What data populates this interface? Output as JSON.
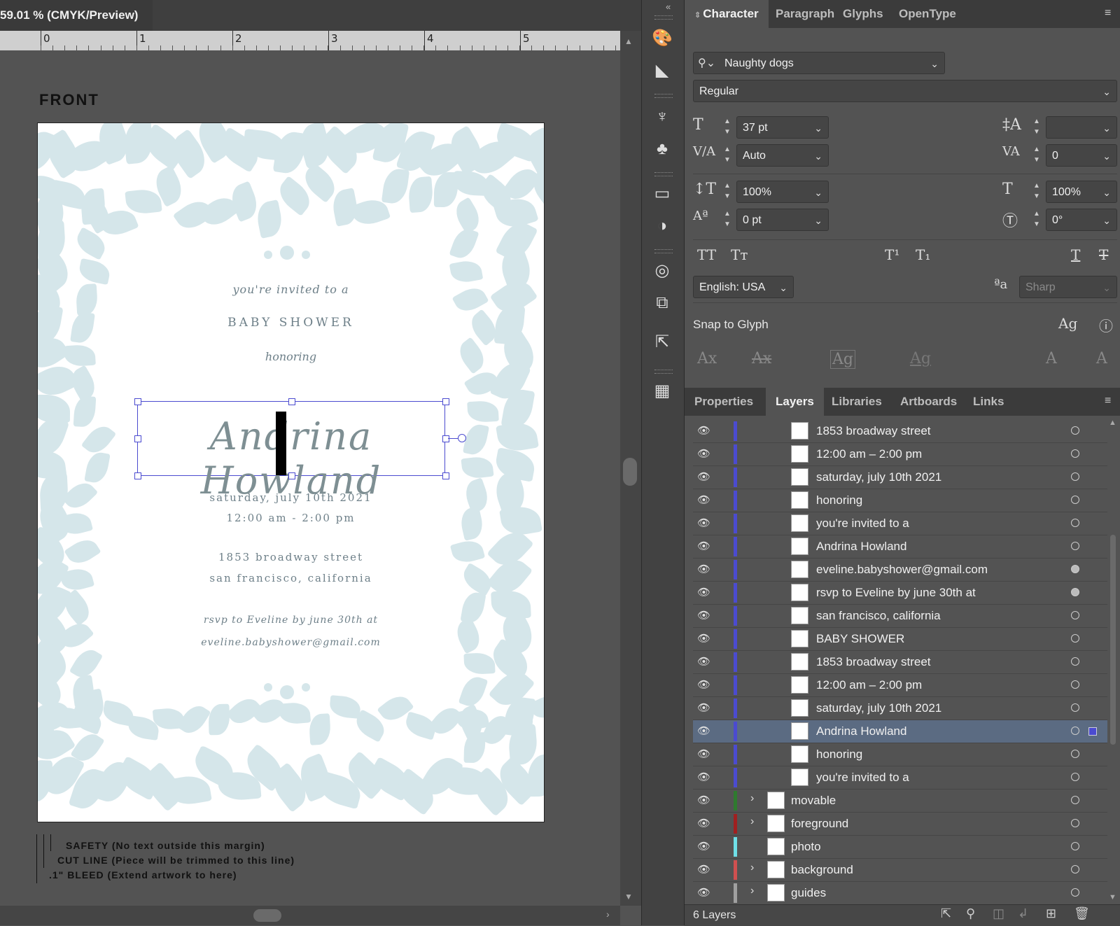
{
  "document": {
    "tab_title": "59.01 % (CMYK/Preview)",
    "ruler_labels": [
      "0",
      "1",
      "2",
      "3",
      "4",
      "5"
    ],
    "front_label": "FRONT",
    "invitation": {
      "line1": "you're invited to a",
      "line2": "BABY SHOWER",
      "line3": "honoring",
      "name": "Andrina Howland",
      "date": "saturday, july 10th 2021",
      "time": "12:00 am - 2:00 pm",
      "street": "1853 broadway street",
      "city": "san francisco, california",
      "rsvp": "rsvp to Eveline by june 30th at",
      "email": "eveline.babyshower@gmail.com"
    },
    "legend": [
      "SAFETY (No text outside this margin)",
      "CUT LINE (Piece will be trimmed to this line)",
      ".1\" BLEED (Extend artwork to here)"
    ]
  },
  "character_panel": {
    "tabs": [
      "Character",
      "Paragraph",
      "Glyphs",
      "OpenType"
    ],
    "font_family": "Naughty dogs",
    "font_style": "Regular",
    "font_size": "37 pt",
    "leading": "",
    "kerning": "Auto",
    "tracking": "0",
    "vertical_scale": "100%",
    "horizontal_scale": "100%",
    "baseline_shift": "0 pt",
    "rotation": "0°",
    "language": "English: USA",
    "antialias": "Sharp",
    "snap_to_glyph": "Snap to Glyph"
  },
  "layers_panel": {
    "tabs": [
      "Properties",
      "Layers",
      "Libraries",
      "Artboards",
      "Links"
    ],
    "rows": [
      {
        "name": "1853 broadway street",
        "selected": false,
        "filled": false
      },
      {
        "name": "12:00 am – 2:00 pm",
        "selected": false,
        "filled": false
      },
      {
        "name": "saturday, july 10th 2021",
        "selected": false,
        "filled": false
      },
      {
        "name": "honoring",
        "selected": false,
        "filled": false
      },
      {
        "name": "you're invited to a",
        "selected": false,
        "filled": false
      },
      {
        "name": "Andrina Howland",
        "selected": false,
        "filled": false
      },
      {
        "name": "eveline.babyshower@gmail.com",
        "selected": false,
        "filled": true
      },
      {
        "name": "rsvp to Eveline by june 30th at",
        "selected": false,
        "filled": true
      },
      {
        "name": "san francisco, california",
        "selected": false,
        "filled": false
      },
      {
        "name": "BABY SHOWER",
        "selected": false,
        "filled": false
      },
      {
        "name": "1853 broadway street",
        "selected": false,
        "filled": false
      },
      {
        "name": "12:00 am – 2:00 pm",
        "selected": false,
        "filled": false
      },
      {
        "name": "saturday, july 10th 2021",
        "selected": false,
        "filled": false
      },
      {
        "name": "Andrina Howland",
        "selected": true,
        "filled": false
      },
      {
        "name": "honoring",
        "selected": false,
        "filled": false
      },
      {
        "name": "you're invited to a",
        "selected": false,
        "filled": false
      }
    ],
    "top_layers": [
      {
        "name": "movable",
        "color": "#2f7a2f",
        "expandable": true
      },
      {
        "name": "foreground",
        "color": "#a02020",
        "expandable": true
      },
      {
        "name": "photo",
        "color": "#6fe0e8",
        "expandable": false
      },
      {
        "name": "background",
        "color": "#d05050",
        "expandable": true
      },
      {
        "name": "guides",
        "color": "#a0a0a0",
        "expandable": true
      }
    ],
    "footer_count": "6 Layers"
  },
  "colors": {
    "selection": "#4b4bd0",
    "foliage": "#d5e6ea",
    "text": "#6d7f88"
  }
}
